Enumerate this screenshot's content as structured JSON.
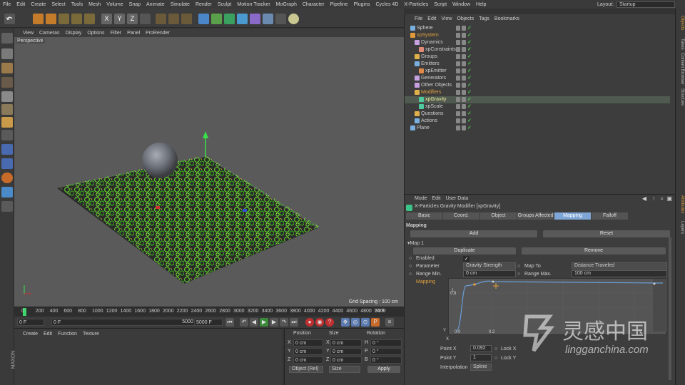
{
  "menubar": {
    "items": [
      "File",
      "Edit",
      "Create",
      "Select",
      "Tools",
      "Mesh",
      "Volume",
      "Snap",
      "Animate",
      "Simulate",
      "Render",
      "Sculpt",
      "Motion Tracker",
      "MoGraph",
      "Character",
      "Pipeline",
      "Plugins",
      "Cycles 4D",
      "X-Particles",
      "Script",
      "Window",
      "Help"
    ],
    "layout_label": "Layout:",
    "layout_value": "Startup"
  },
  "viewport": {
    "menu": [
      "View",
      "Cameras",
      "Display",
      "Options",
      "Filter",
      "Panel",
      "ProRender"
    ],
    "label": "Perspective",
    "grid_spacing": "Grid Spacing : 100 cm"
  },
  "timeline": {
    "ticks": [
      "0",
      "200",
      "400",
      "600",
      "800",
      "1000",
      "1200",
      "1400",
      "1600",
      "1800",
      "2000",
      "2200",
      "2400",
      "2600",
      "2800",
      "3000",
      "3200",
      "3400",
      "3600",
      "3800",
      "4000",
      "4200",
      "4400",
      "4600",
      "4800",
      "5000"
    ],
    "frame_label": "74 F",
    "start": "0 F",
    "start2": "0 F",
    "end": "5000 F",
    "end2": "5000 F"
  },
  "material": {
    "menu": [
      "Create",
      "Edit",
      "Function",
      "Texture"
    ]
  },
  "coords": {
    "headers": [
      "Position",
      "Size",
      "Rotation"
    ],
    "rows": [
      {
        "axis": "X",
        "pos": "0 cm",
        "size_axis": "X",
        "size": "0 cm",
        "rot_axis": "H",
        "rot": "0 °"
      },
      {
        "axis": "Y",
        "pos": "0 cm",
        "size_axis": "Y",
        "size": "0 cm",
        "rot_axis": "P",
        "rot": "0 °"
      },
      {
        "axis": "Z",
        "pos": "0 cm",
        "size_axis": "Z",
        "size": "0 cm",
        "rot_axis": "B",
        "rot": "0 °"
      }
    ],
    "mode": "Object (Rel)",
    "size_mode": "Size",
    "apply": "Apply"
  },
  "objects": {
    "menu": [
      "File",
      "Edit",
      "View",
      "Objects",
      "Tags",
      "Bookmarks"
    ],
    "items": [
      {
        "name": "Sphere",
        "indent": 0,
        "color": "#7ab0e0"
      },
      {
        "name": "xpSystem",
        "indent": 0,
        "color": "#e09a3a"
      },
      {
        "name": "Dynamics",
        "indent": 1,
        "color": "#c7a0e0"
      },
      {
        "name": "xpConstraints",
        "indent": 2,
        "color": "#e08a7a"
      },
      {
        "name": "Groups",
        "indent": 1,
        "color": "#e0b04a"
      },
      {
        "name": "Emitters",
        "indent": 1,
        "color": "#7ab0e0"
      },
      {
        "name": "xpEmitter",
        "indent": 2,
        "color": "#e08a4a"
      },
      {
        "name": "Generators",
        "indent": 1,
        "color": "#c7a0e0"
      },
      {
        "name": "Other Objects",
        "indent": 1,
        "color": "#c7a0e0"
      },
      {
        "name": "Modifiers",
        "indent": 1,
        "color": "#e0b04a"
      },
      {
        "name": "xpGravity",
        "indent": 2,
        "color": "#4ecb9e"
      },
      {
        "name": "xpScale",
        "indent": 2,
        "color": "#4ecb9e"
      },
      {
        "name": "Questions",
        "indent": 1,
        "color": "#e0b04a"
      },
      {
        "name": "Actions",
        "indent": 1,
        "color": "#7ab0e0"
      },
      {
        "name": "Plane",
        "indent": 0,
        "color": "#7ab0e0"
      }
    ]
  },
  "attributes": {
    "menu": [
      "Mode",
      "Edit",
      "User Data"
    ],
    "title": "X-Particles Gravity Modifier [xpGravity]",
    "tabs": [
      "Basic",
      "Coord.",
      "Object",
      "Groups Affected",
      "Mapping",
      "Falloff"
    ],
    "active_tab": "Mapping",
    "section": "Mapping",
    "add": "Add",
    "reset": "Reset",
    "map_label": "Map 1",
    "duplicate": "Duplicate",
    "remove": "Remove",
    "enabled_label": "Enabled",
    "enabled_check": "✓",
    "parameter_label": "Parameter",
    "parameter_value": "Gravity Strength",
    "map_to_label": "Map To",
    "map_to_value": "Distance Traveled",
    "range_min_label": "Range Min.",
    "range_min_value": "0 cm",
    "range_max_label": "Range Max.",
    "range_max_value": "100 cm",
    "mapping_label": "Mapping",
    "curve_y_top": "1",
    "curve_y_mid": "0.8",
    "curve_y": "Y",
    "curve_x": "X",
    "curve_ticks": [
      "0.0",
      "0.2"
    ],
    "point_x_label": "Point X",
    "point_x_value": "0.092",
    "point_y_label": "Point Y",
    "point_y_value": "1",
    "lock_x": "Lock X",
    "lock_y": "Lock Y",
    "interp_label": "Interpolation",
    "interp_value": "Spline"
  },
  "right_tabs": [
    "Objects",
    "Takes",
    "Content Browser",
    "Structure",
    "Attributes",
    "Layers"
  ],
  "watermark": {
    "cn": "灵感中国",
    "url": "lingganchina.com"
  }
}
